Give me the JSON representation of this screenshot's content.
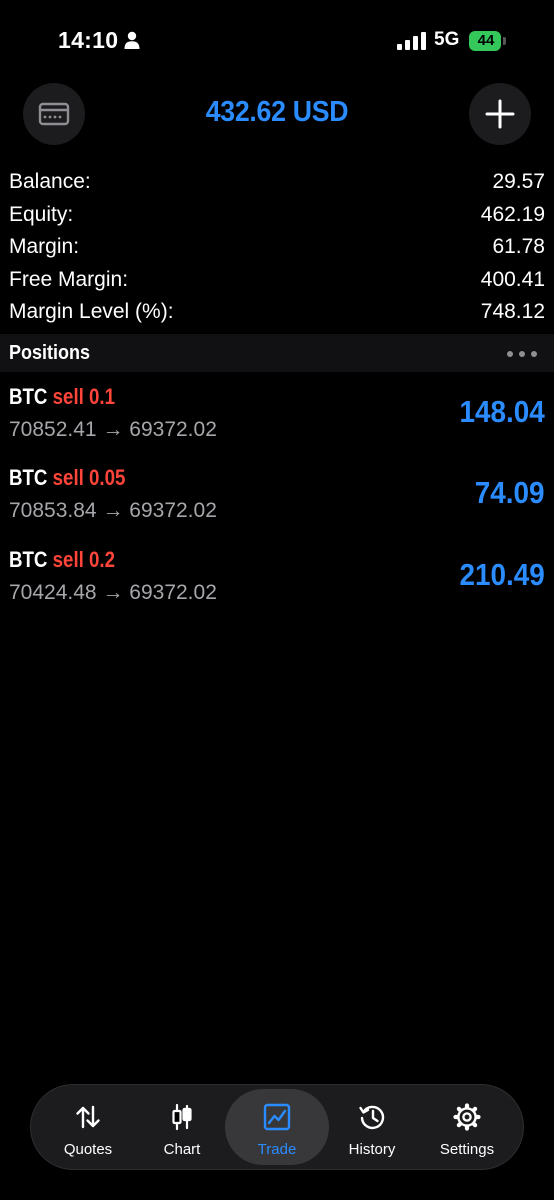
{
  "status_bar": {
    "time": "14:10",
    "network": "5G",
    "battery": "44",
    "icons": [
      "person-icon",
      "signal-icon",
      "battery-icon"
    ]
  },
  "header": {
    "title": "432.62 USD",
    "left_icon": "card-icon",
    "right_icon": "plus-icon"
  },
  "summary": [
    {
      "label": "Balance:",
      "value": "29.57"
    },
    {
      "label": "Equity:",
      "value": "462.19"
    },
    {
      "label": "Margin:",
      "value": "61.78"
    },
    {
      "label": "Free Margin:",
      "value": "400.41"
    },
    {
      "label": "Margin Level (%):",
      "value": "748.12"
    }
  ],
  "positions": {
    "title": "Positions",
    "more_icon": "more-icon",
    "items": [
      {
        "symbol": "BTC",
        "type": "sell 0.1",
        "open_price": "70852.41",
        "arrow": "→",
        "current_price": "69372.02",
        "profit": "148.04"
      },
      {
        "symbol": "BTC",
        "type": "sell 0.05",
        "open_price": "70853.84",
        "arrow": "→",
        "current_price": "69372.02",
        "profit": "74.09"
      },
      {
        "symbol": "BTC",
        "type": "sell 0.2",
        "open_price": "70424.48",
        "arrow": "→",
        "current_price": "69372.02",
        "profit": "210.49"
      }
    ]
  },
  "tabs": [
    {
      "label": "Quotes",
      "icon": "quotes-icon",
      "active": false
    },
    {
      "label": "Chart",
      "icon": "chart-icon",
      "active": false
    },
    {
      "label": "Trade",
      "icon": "trade-icon",
      "active": true
    },
    {
      "label": "History",
      "icon": "history-icon",
      "active": false
    },
    {
      "label": "Settings",
      "icon": "settings-icon",
      "active": false
    }
  ],
  "colors": {
    "accent": "#2a8cff",
    "sell": "#ff453a",
    "background": "#000000",
    "battery": "#34c759"
  }
}
